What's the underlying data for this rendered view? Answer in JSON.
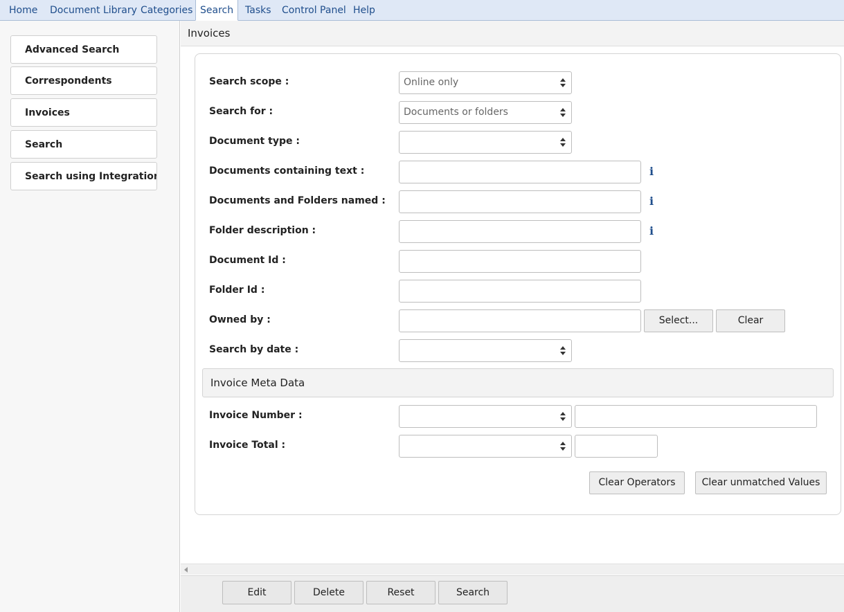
{
  "nav": {
    "tabs": [
      {
        "label": "Home"
      },
      {
        "label": "Document Library"
      },
      {
        "label": "Categories"
      },
      {
        "label": "Search",
        "active": true
      },
      {
        "label": "Tasks"
      },
      {
        "label": "Control Panel"
      },
      {
        "label": "Help"
      }
    ]
  },
  "sidebar": {
    "items": [
      {
        "label": "Advanced Search"
      },
      {
        "label": "Correspondents"
      },
      {
        "label": "Invoices"
      },
      {
        "label": "Search"
      },
      {
        "label": "Search using Integration No"
      }
    ]
  },
  "page": {
    "title": "Invoices"
  },
  "form": {
    "search_scope": {
      "label": "Search scope :",
      "value": "Online only"
    },
    "search_for": {
      "label": "Search for :",
      "value": "Documents or folders"
    },
    "document_type": {
      "label": "Document type :",
      "value": ""
    },
    "containing_text": {
      "label": "Documents containing text :",
      "value": ""
    },
    "named": {
      "label": "Documents and Folders named :",
      "value": ""
    },
    "folder_description": {
      "label": "Folder description :",
      "value": ""
    },
    "document_id": {
      "label": "Document Id :",
      "value": ""
    },
    "folder_id": {
      "label": "Folder Id :",
      "value": ""
    },
    "owned_by": {
      "label": "Owned by :",
      "value": "",
      "select_label": "Select...",
      "clear_label": "Clear"
    },
    "search_by_date": {
      "label": "Search by date :",
      "value": ""
    },
    "info_glyph": "i"
  },
  "meta": {
    "title": "Invoice Meta Data",
    "invoice_number": {
      "label": "Invoice Number :",
      "operator": "",
      "value": ""
    },
    "invoice_total": {
      "label": "Invoice Total :",
      "operator": "",
      "value": ""
    },
    "clear_operators_label": "Clear Operators",
    "clear_unmatched_label": "Clear unmatched Values"
  },
  "footer": {
    "edit_label": "Edit",
    "delete_label": "Delete",
    "reset_label": "Reset",
    "search_label": "Search"
  },
  "colors": {
    "nav_bg": "#dfe8f6",
    "link": "#1f4e8c"
  }
}
